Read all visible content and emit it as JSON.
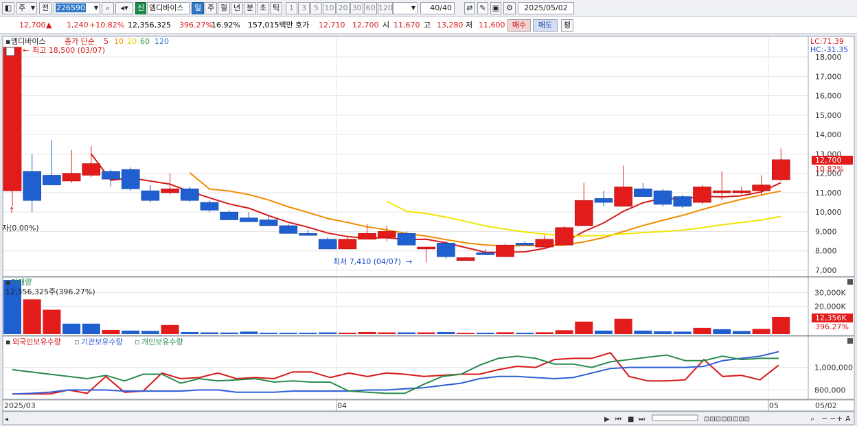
{
  "toolbar": {
    "market_select": "주",
    "market_select2": "전",
    "code_input": "226590",
    "badge_new": "신",
    "stock_name": "엠디바이스",
    "periods": [
      "일",
      "주",
      "월",
      "년",
      "분",
      "초",
      "틱"
    ],
    "active_period": "일",
    "intervals": [
      "1",
      "3",
      "5",
      "10",
      "20",
      "30",
      "60",
      "120"
    ],
    "count": "40/40",
    "date": "2025/05/02"
  },
  "info": {
    "price": "12,700",
    "change": "1,240",
    "change_pct": "+10.82%",
    "volume": "12,356,325",
    "vol_ratio": "396.27%",
    "turnover": "16.92%",
    "amount": "157,015백만",
    "quote_label": "호가",
    "quote1": "12,710",
    "quote2": "12,700",
    "open_label": "시",
    "open": "11,670",
    "high_label": "고",
    "high": "13,280",
    "low_label": "저",
    "low": "11,600",
    "buy_btn": "매수",
    "sell_btn": "매도",
    "eval_btn": "평"
  },
  "price_panel": {
    "stock_tab": "엠디바이스",
    "ma_label": "종가 단순",
    "ma_periods": [
      "5",
      "10",
      "20",
      "60",
      "120"
    ],
    "ma_colors": [
      "#d81818",
      "#f08c00",
      "#f0e600",
      "#2aa040",
      "#2e78c7"
    ],
    "high_note": "최고 18,500 (03/07)",
    "low_note": "최저 7,410 (04/07)",
    "left_note": "자(0.00%)",
    "lc": "LC:71.39",
    "hc": "HC:-31.35",
    "price_tag": "12,700",
    "pct_tag": "10.82%",
    "y_ticks": [
      "18,000",
      "17,000",
      "16,000",
      "15,000",
      "14,000",
      "13,000",
      "12,000",
      "11,000",
      "10,000",
      "9,000",
      "8,000",
      "7,000"
    ]
  },
  "volume_panel": {
    "title": "거래량",
    "note": "12,356,325주(396.27%)",
    "y_ticks": [
      "30,000K",
      "20,000K"
    ],
    "vol_tag": "12,356K",
    "vol_pct": "396.27%"
  },
  "holding_panel": {
    "legend": [
      "외국인보유수량",
      "기관보유수량",
      "개인보유수량"
    ],
    "legend_colors": [
      "#d81818",
      "#2e5fd8",
      "#2a8a50"
    ],
    "y_ticks": [
      "1,000,000",
      "800,000"
    ]
  },
  "x_axis": {
    "labels": [
      "2025/03",
      "04",
      "05"
    ],
    "end_date": "05/02"
  },
  "chart_data": {
    "type": "candlestick",
    "ylim": [
      6700,
      18600
    ],
    "candles": [
      {
        "o": 11100,
        "h": 18500,
        "l": 10300,
        "c": 18500
      },
      {
        "o": 12100,
        "h": 13000,
        "l": 10000,
        "c": 10600
      },
      {
        "o": 11900,
        "h": 13700,
        "l": 11400,
        "c": 11400
      },
      {
        "o": 11600,
        "h": 13200,
        "l": 11500,
        "c": 12000
      },
      {
        "o": 11900,
        "h": 13400,
        "l": 11800,
        "c": 12500
      },
      {
        "o": 12100,
        "h": 12200,
        "l": 11300,
        "c": 11700
      },
      {
        "o": 12200,
        "h": 12300,
        "l": 11100,
        "c": 11200
      },
      {
        "o": 11100,
        "h": 11400,
        "l": 10500,
        "c": 10600
      },
      {
        "o": 11000,
        "h": 12000,
        "l": 10900,
        "c": 11200
      },
      {
        "o": 11200,
        "h": 11300,
        "l": 10500,
        "c": 10600
      },
      {
        "o": 10500,
        "h": 10600,
        "l": 10000,
        "c": 10100
      },
      {
        "o": 10000,
        "h": 10100,
        "l": 9600,
        "c": 9600
      },
      {
        "o": 9700,
        "h": 10000,
        "l": 9500,
        "c": 9500
      },
      {
        "o": 9600,
        "h": 9800,
        "l": 9300,
        "c": 9300
      },
      {
        "o": 9300,
        "h": 9400,
        "l": 8900,
        "c": 8900
      },
      {
        "o": 8900,
        "h": 9100,
        "l": 8800,
        "c": 8800
      },
      {
        "o": 8600,
        "h": 8700,
        "l": 8100,
        "c": 8100
      },
      {
        "o": 8100,
        "h": 8700,
        "l": 8100,
        "c": 8600
      },
      {
        "o": 8600,
        "h": 9400,
        "l": 8600,
        "c": 8900
      },
      {
        "o": 8700,
        "h": 9300,
        "l": 8500,
        "c": 9000
      },
      {
        "o": 8900,
        "h": 9000,
        "l": 8300,
        "c": 8300
      },
      {
        "o": 8100,
        "h": 8200,
        "l": 7410,
        "c": 8200
      },
      {
        "o": 8400,
        "h": 8500,
        "l": 7600,
        "c": 7700
      },
      {
        "o": 7500,
        "h": 7700,
        "l": 7500,
        "c": 7650
      },
      {
        "o": 7900,
        "h": 8100,
        "l": 7800,
        "c": 7800
      },
      {
        "o": 7700,
        "h": 8400,
        "l": 7700,
        "c": 8300
      },
      {
        "o": 8400,
        "h": 8500,
        "l": 8300,
        "c": 8300
      },
      {
        "o": 8200,
        "h": 8800,
        "l": 8200,
        "c": 8600
      },
      {
        "o": 8300,
        "h": 9300,
        "l": 8300,
        "c": 9200
      },
      {
        "o": 9300,
        "h": 11500,
        "l": 9300,
        "c": 10600
      },
      {
        "o": 10700,
        "h": 11100,
        "l": 10300,
        "c": 10500
      },
      {
        "o": 10300,
        "h": 12400,
        "l": 10300,
        "c": 11300
      },
      {
        "o": 11200,
        "h": 11500,
        "l": 10800,
        "c": 10800
      },
      {
        "o": 11100,
        "h": 11200,
        "l": 10300,
        "c": 10400
      },
      {
        "o": 10800,
        "h": 10900,
        "l": 10200,
        "c": 10300
      },
      {
        "o": 10500,
        "h": 11400,
        "l": 10400,
        "c": 11300
      },
      {
        "o": 11000,
        "h": 12100,
        "l": 10600,
        "c": 11100
      },
      {
        "o": 11000,
        "h": 11300,
        "l": 10900,
        "c": 11100
      },
      {
        "o": 11100,
        "h": 11900,
        "l": 10900,
        "c": 11400
      },
      {
        "o": 11670,
        "h": 13280,
        "l": 11600,
        "c": 12700
      }
    ],
    "volume": [
      {
        "v": 39000,
        "up": false
      },
      {
        "v": 25000,
        "up": true
      },
      {
        "v": 17500,
        "up": true
      },
      {
        "v": 7500,
        "up": false
      },
      {
        "v": 7500,
        "up": false
      },
      {
        "v": 3000,
        "up": true
      },
      {
        "v": 2500,
        "up": false
      },
      {
        "v": 2300,
        "up": false
      },
      {
        "v": 6500,
        "up": true
      },
      {
        "v": 1500,
        "up": false
      },
      {
        "v": 1200,
        "up": false
      },
      {
        "v": 1100,
        "up": false
      },
      {
        "v": 1800,
        "up": false
      },
      {
        "v": 1000,
        "up": false
      },
      {
        "v": 1000,
        "up": false
      },
      {
        "v": 1000,
        "up": false
      },
      {
        "v": 1200,
        "up": false
      },
      {
        "v": 1000,
        "up": true
      },
      {
        "v": 1500,
        "up": true
      },
      {
        "v": 1200,
        "up": true
      },
      {
        "v": 1200,
        "up": false
      },
      {
        "v": 1200,
        "up": true
      },
      {
        "v": 1500,
        "up": false
      },
      {
        "v": 900,
        "up": true
      },
      {
        "v": 1000,
        "up": false
      },
      {
        "v": 1300,
        "up": true
      },
      {
        "v": 1000,
        "up": false
      },
      {
        "v": 1300,
        "up": true
      },
      {
        "v": 2800,
        "up": true
      },
      {
        "v": 9000,
        "up": true
      },
      {
        "v": 2500,
        "up": false
      },
      {
        "v": 11000,
        "up": true
      },
      {
        "v": 2500,
        "up": false
      },
      {
        "v": 2000,
        "up": false
      },
      {
        "v": 1800,
        "up": false
      },
      {
        "v": 4500,
        "up": true
      },
      {
        "v": 3500,
        "up": false
      },
      {
        "v": 2200,
        "up": false
      },
      {
        "v": 3700,
        "up": true
      },
      {
        "v": 12356,
        "up": true
      }
    ],
    "holdings": {
      "ylim": [
        730000,
        1180000
      ],
      "foreign": [
        765000,
        765000,
        765000,
        800000,
        770000,
        920000,
        780000,
        790000,
        950000,
        900000,
        910000,
        950000,
        900000,
        910000,
        900000,
        960000,
        960000,
        910000,
        950000,
        920000,
        950000,
        940000,
        920000,
        930000,
        940000,
        940000,
        980000,
        1010000,
        1000000,
        1070000,
        1080000,
        1080000,
        1130000,
        920000,
        880000,
        880000,
        890000,
        1070000,
        920000,
        930000,
        890000,
        1020000
      ],
      "institution": [
        765000,
        770000,
        780000,
        800000,
        800000,
        800000,
        790000,
        790000,
        790000,
        790000,
        800000,
        800000,
        780000,
        780000,
        780000,
        790000,
        790000,
        790000,
        790000,
        800000,
        800000,
        810000,
        820000,
        840000,
        860000,
        900000,
        920000,
        920000,
        910000,
        900000,
        910000,
        950000,
        990000,
        1000000,
        1000000,
        1000000,
        1000000,
        1010000,
        1060000,
        1080000,
        1100000,
        1140000
      ],
      "individual": [
        980000,
        960000,
        940000,
        920000,
        900000,
        930000,
        880000,
        940000,
        940000,
        860000,
        900000,
        880000,
        890000,
        900000,
        870000,
        880000,
        870000,
        870000,
        790000,
        780000,
        770000,
        770000,
        850000,
        920000,
        940000,
        1020000,
        1080000,
        1100000,
        1080000,
        1030000,
        1030000,
        1000000,
        1050000,
        1070000,
        1090000,
        1110000,
        1060000,
        1060000,
        1100000,
        1070000,
        1080000,
        1080000
      ]
    }
  }
}
